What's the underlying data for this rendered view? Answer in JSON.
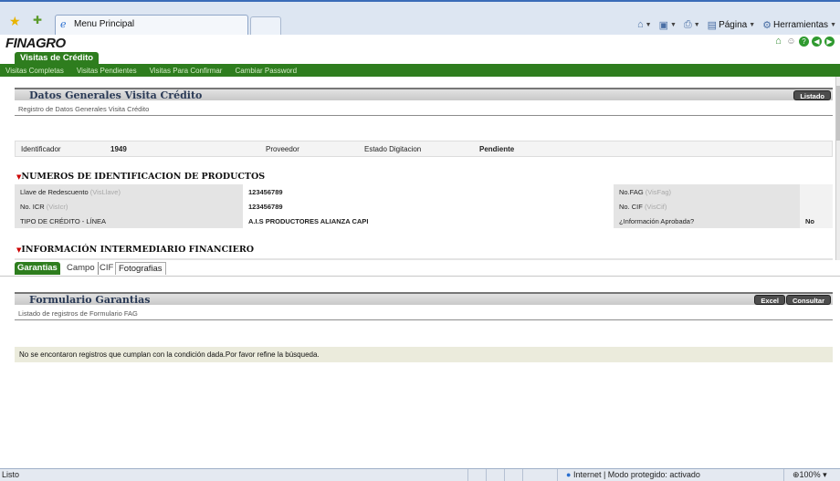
{
  "browser": {
    "tab_title": "Menu Principal",
    "commands": [
      {
        "icon": "home-icon",
        "label": ""
      },
      {
        "icon": "feeds-icon",
        "label": ""
      },
      {
        "icon": "print-icon",
        "label": ""
      },
      {
        "icon": "page-icon",
        "label": "Página"
      },
      {
        "icon": "tools-icon",
        "label": "Herramientas"
      }
    ]
  },
  "app": {
    "logo": "FINAGRO",
    "module_tab": "Visitas de Crédito",
    "menu": [
      "Visitas Completas",
      "Visitas Pendientes",
      "Visitas Para Confirmar",
      "Cambiar Password"
    ]
  },
  "datos": {
    "title": "Datos Generales Visita Crédito",
    "subtitle": "Registro de Datos Generales Visita Crédito",
    "listado_button": "Listado",
    "identificador_label": "Identificador",
    "identificador_value": "1949",
    "proveedor_label": "Proveedor",
    "estado_label": "Estado Digitacion",
    "estado_value": "Pendiente"
  },
  "productos": {
    "title": "NUMEROS DE IDENTIFICACION DE PRODUCTOS",
    "rows": [
      {
        "label": "Llave de Redescuento",
        "hint": "(VisLlave)",
        "value": "123456789",
        "label2": "No.FAG",
        "hint2": "(VisFag)",
        "value2": ""
      },
      {
        "label": "No. ICR",
        "hint": "(VisIcr)",
        "value": "123456789",
        "label2": "No. CIF",
        "hint2": "(VisCif)",
        "value2": ""
      },
      {
        "label": "TIPO DE CRÉDITO - LÍNEA",
        "hint": "",
        "value": "A.I.S PRODUCTORES ALIANZA CAPI",
        "label2": "¿Información Aprobada?",
        "hint2": "",
        "value2": "No"
      }
    ]
  },
  "intermediario": {
    "title": "INFORMACIÓN INTERMEDIARIO FINANCIERO"
  },
  "tabs": [
    "Garantias",
    "Campo",
    "CIF",
    "Fotografias"
  ],
  "formulario": {
    "title": "Formulario Garantias",
    "subtitle": "Listado de registros de Formulario FAG",
    "excel_button": "Excel",
    "consultar_button": "Consultar",
    "empty_message": "No se encontaron registros que cumplan con la condición dada.Por favor refine la búsqueda."
  },
  "status": {
    "text": "Listo",
    "zone": "Internet | Modo protegido: activado",
    "zoom": "100%"
  },
  "colors": {
    "brand_green": "#2e7d1e",
    "header_navy": "#2a3a56"
  }
}
